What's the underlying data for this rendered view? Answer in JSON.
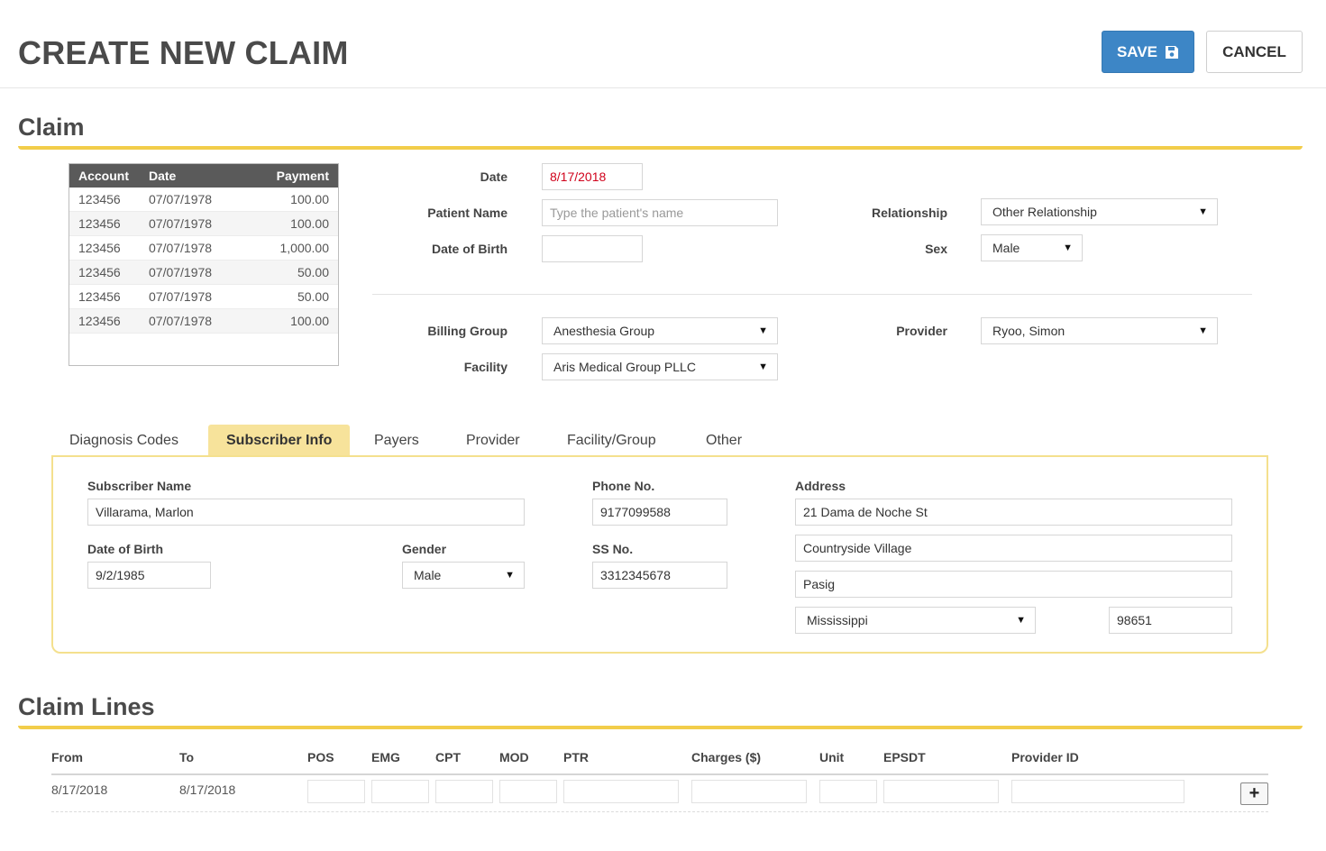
{
  "header": {
    "title": "CREATE NEW CLAIM",
    "save_label": "SAVE",
    "cancel_label": "CANCEL"
  },
  "claim": {
    "section_title": "Claim",
    "payments": {
      "columns": [
        "Account",
        "Date",
        "Payment"
      ],
      "rows": [
        [
          "123456",
          "07/07/1978",
          "100.00"
        ],
        [
          "123456",
          "07/07/1978",
          "100.00"
        ],
        [
          "123456",
          "07/07/1978",
          "1,000.00"
        ],
        [
          "123456",
          "07/07/1978",
          "50.00"
        ],
        [
          "123456",
          "07/07/1978",
          "50.00"
        ],
        [
          "123456",
          "07/07/1978",
          "100.00"
        ]
      ]
    },
    "date_label": "Date",
    "date_value": "8/17/2018",
    "patient_name_label": "Patient Name",
    "patient_name_placeholder": "Type the patient's name",
    "dob_label": "Date of Birth",
    "dob_value": "",
    "relationship_label": "Relationship",
    "relationship_value": "Other Relationship",
    "sex_label": "Sex",
    "sex_value": "Male",
    "billing_group_label": "Billing Group",
    "billing_group_value": "Anesthesia Group",
    "facility_label": "Facility",
    "facility_value": "Aris Medical Group PLLC",
    "provider_label": "Provider",
    "provider_value": "Ryoo, Simon"
  },
  "tabs": [
    "Diagnosis Codes",
    "Subscriber Info",
    "Payers",
    "Provider",
    "Facility/Group",
    "Other"
  ],
  "active_tab": "Subscriber Info",
  "subscriber": {
    "name_label": "Subscriber Name",
    "name_value": "Villarama, Marlon",
    "dob_label": "Date of Birth",
    "dob_value": "9/2/1985",
    "gender_label": "Gender",
    "gender_value": "Male",
    "phone_label": "Phone No.",
    "phone_value": "9177099588",
    "ss_label": "SS No.",
    "ss_value": "3312345678",
    "address_label": "Address",
    "address_line1": "21 Dama de Noche St",
    "address_line2": "Countryside Village",
    "city": "Pasig",
    "state": "Mississippi",
    "zip": "98651"
  },
  "claim_lines": {
    "section_title": "Claim Lines",
    "columns": [
      "From",
      "To",
      "POS",
      "EMG",
      "CPT",
      "MOD",
      "PTR",
      "Charges ($)",
      "Unit",
      "EPSDT",
      "Provider ID"
    ],
    "rows": [
      {
        "from": "8/17/2018",
        "to": "8/17/2018"
      }
    ],
    "add_label": "+"
  },
  "colors": {
    "accent": "#3d86c6",
    "gold": "#f2cd4a",
    "tab_active": "#f7e39b",
    "date_red": "#d0021b"
  }
}
